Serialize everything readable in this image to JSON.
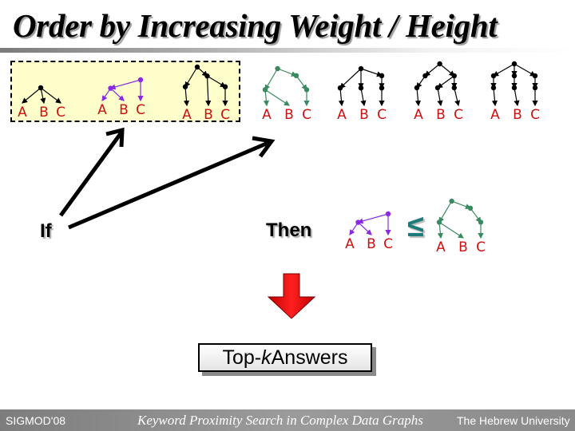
{
  "slide": {
    "title": "Order by Increasing Weight / Height",
    "if_label": "If",
    "then_label": "Then",
    "leq_symbol": "≤",
    "result_box": {
      "prefix": "Top-",
      "k": "k",
      "suffix": " Answers"
    }
  },
  "footer": {
    "left": "SIGMOD'08",
    "center": "Keyword Proximity Search in Complex Data Graphs",
    "right": "The Hebrew University"
  },
  "colors": {
    "keyword_label": "#cc1111",
    "tree_black": "#000000",
    "tree_purple": "#8a2be2",
    "tree_green": "#3a8a60",
    "highlight_fill": "#ffffcc",
    "arrow_red": "#ee1111",
    "leq": "#1d7b7b"
  },
  "keywords": [
    "A",
    "B",
    "C"
  ],
  "trees": [
    {
      "id": "tree-1",
      "color": "tree_black",
      "highlighted": true,
      "nodes": [
        [
          0.5,
          0
        ]
      ],
      "edges": [
        [
          0,
          "A"
        ],
        [
          0,
          "B"
        ],
        [
          0,
          "C"
        ]
      ]
    },
    {
      "id": "tree-2",
      "color": "tree_purple",
      "highlighted": true,
      "nodes": [
        [
          0.25,
          0.33
        ],
        [
          1,
          0
        ]
      ],
      "edges": [
        [
          1,
          0
        ],
        [
          0,
          "A"
        ],
        [
          0,
          "B"
        ],
        [
          1,
          "C"
        ]
      ]
    },
    {
      "id": "tree-3",
      "color": "tree_black",
      "highlighted": true,
      "nodes": [
        [
          0.3,
          0
        ],
        [
          0.55,
          0.25
        ],
        [
          0,
          0.55
        ],
        [
          1,
          0.55
        ]
      ],
      "edges": [
        [
          0,
          2
        ],
        [
          0,
          1
        ],
        [
          1,
          3
        ],
        [
          2,
          "A"
        ],
        [
          1,
          "B"
        ],
        [
          3,
          "C"
        ]
      ]
    },
    {
      "id": "tree-4",
      "color": "tree_green",
      "highlighted": false,
      "nodes": [
        [
          0.3,
          0
        ],
        [
          0.75,
          0.2
        ],
        [
          0,
          0.6
        ],
        [
          1,
          0.6
        ]
      ],
      "edges": [
        [
          0,
          1
        ],
        [
          0,
          2
        ],
        [
          1,
          3
        ],
        [
          2,
          "A"
        ],
        [
          2,
          "B"
        ],
        [
          3,
          "C"
        ]
      ]
    },
    {
      "id": "tree-5",
      "color": "tree_black",
      "highlighted": false,
      "nodes": [
        [
          0.5,
          0
        ],
        [
          0,
          0.55
        ],
        [
          0.5,
          0.55
        ],
        [
          1,
          0.2
        ],
        [
          1,
          0.55
        ]
      ],
      "edges": [
        [
          0,
          1
        ],
        [
          0,
          2
        ],
        [
          0,
          3
        ],
        [
          3,
          4
        ],
        [
          1,
          "A"
        ],
        [
          2,
          "B"
        ],
        [
          4,
          "C"
        ]
      ]
    },
    {
      "id": "tree-6",
      "color": "tree_black",
      "highlighted": false,
      "nodes": [
        [
          0.55,
          0
        ],
        [
          0.2,
          0.3
        ],
        [
          0,
          0.6
        ],
        [
          0.9,
          0.3
        ],
        [
          0.5,
          0.6
        ],
        [
          0.9,
          0.6
        ]
      ],
      "edges": [
        [
          0,
          1
        ],
        [
          0,
          3
        ],
        [
          1,
          2
        ],
        [
          3,
          4
        ],
        [
          3,
          5
        ],
        [
          2,
          "A"
        ],
        [
          4,
          "B"
        ],
        [
          5,
          "C"
        ]
      ]
    },
    {
      "id": "tree-7",
      "color": "tree_black",
      "highlighted": false,
      "nodes": [
        [
          0.5,
          0
        ],
        [
          0,
          0.3
        ],
        [
          0,
          0.6
        ],
        [
          0.5,
          0.3
        ],
        [
          0.5,
          0.6
        ],
        [
          1,
          0.3
        ],
        [
          1,
          0.6
        ]
      ],
      "edges": [
        [
          0,
          1
        ],
        [
          0,
          3
        ],
        [
          0,
          5
        ],
        [
          1,
          2
        ],
        [
          3,
          4
        ],
        [
          5,
          6
        ],
        [
          2,
          "A"
        ],
        [
          4,
          "B"
        ],
        [
          6,
          "C"
        ]
      ]
    }
  ],
  "comparison": {
    "left_tree": "tree-2",
    "right_tree": "tree-4"
  },
  "arrows": [
    {
      "from": "if",
      "to": "highlighted-group"
    },
    {
      "from": "if",
      "to": "tree-4"
    }
  ]
}
